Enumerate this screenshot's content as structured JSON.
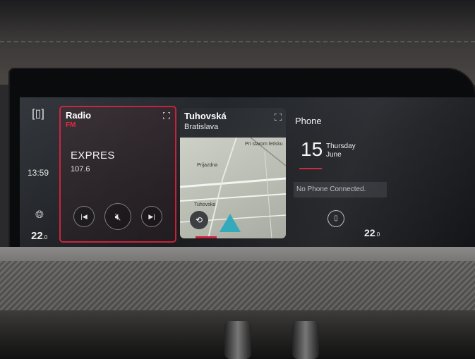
{
  "rail": {
    "multi_icon": "multi-screen-icon",
    "time": "13:59",
    "globe_icon": "globe-location-icon",
    "temp_left": "22",
    "temp_left_unit": ".0"
  },
  "radio": {
    "title": "Radio",
    "band": "FM",
    "station": "EXPRES",
    "frequency": "107.6",
    "prev_icon": "skip-previous-icon",
    "mute_icon": "mute-icon",
    "next_icon": "skip-next-icon",
    "expand_icon": "expand-icon"
  },
  "nav": {
    "street": "Tuhovská",
    "city": "Bratislava",
    "map_labels": [
      "Pri starom letisku",
      "Prijazdna",
      "Tuhovska"
    ],
    "recent_icon": "history-icon",
    "position_icon": "navigation-arrow-icon",
    "expand_icon": "expand-icon"
  },
  "phone": {
    "title": "Phone",
    "day": "15",
    "weekday": "Thursday",
    "month": "June",
    "status": "No Phone Connected.",
    "phone_icon": "phone-device-icon",
    "temp_right": "22",
    "temp_right_unit": ".0"
  },
  "colors": {
    "accent": "#c8203a",
    "nav_arrow": "#2fa8b8",
    "screen_bg": "#1b1d21"
  }
}
